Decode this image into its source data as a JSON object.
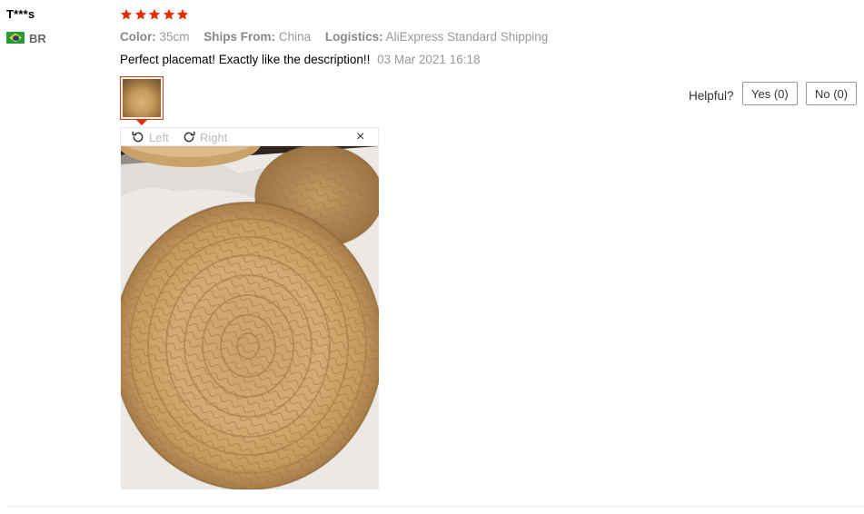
{
  "review": {
    "username": "T***s",
    "country": "BR",
    "rating": 5,
    "color_label": "Color:",
    "color_value": "35cm",
    "ships_label": "Ships From:",
    "ships_value": "China",
    "logistics_label": "Logistics:",
    "logistics_value": "AliExpress Standard Shipping",
    "text": "Perfect placemat! Exactly like the description!!",
    "date": "03 Mar 2021 16:18"
  },
  "helpful": {
    "label": "Helpful?",
    "yes_label": "Yes (0)",
    "no_label": "No (0)"
  },
  "viewer": {
    "rotate_left_label": "Left",
    "rotate_right_label": "Right",
    "close_label": "×"
  },
  "icons": {
    "star": "star-icon",
    "flag": "brazil-flag-icon",
    "rotate_left": "rotate-left-icon",
    "rotate_right": "rotate-right-icon",
    "close": "close-icon"
  },
  "colors": {
    "star": "#e62e04",
    "accent_border": "#e62e04",
    "muted_text": "#999999"
  }
}
